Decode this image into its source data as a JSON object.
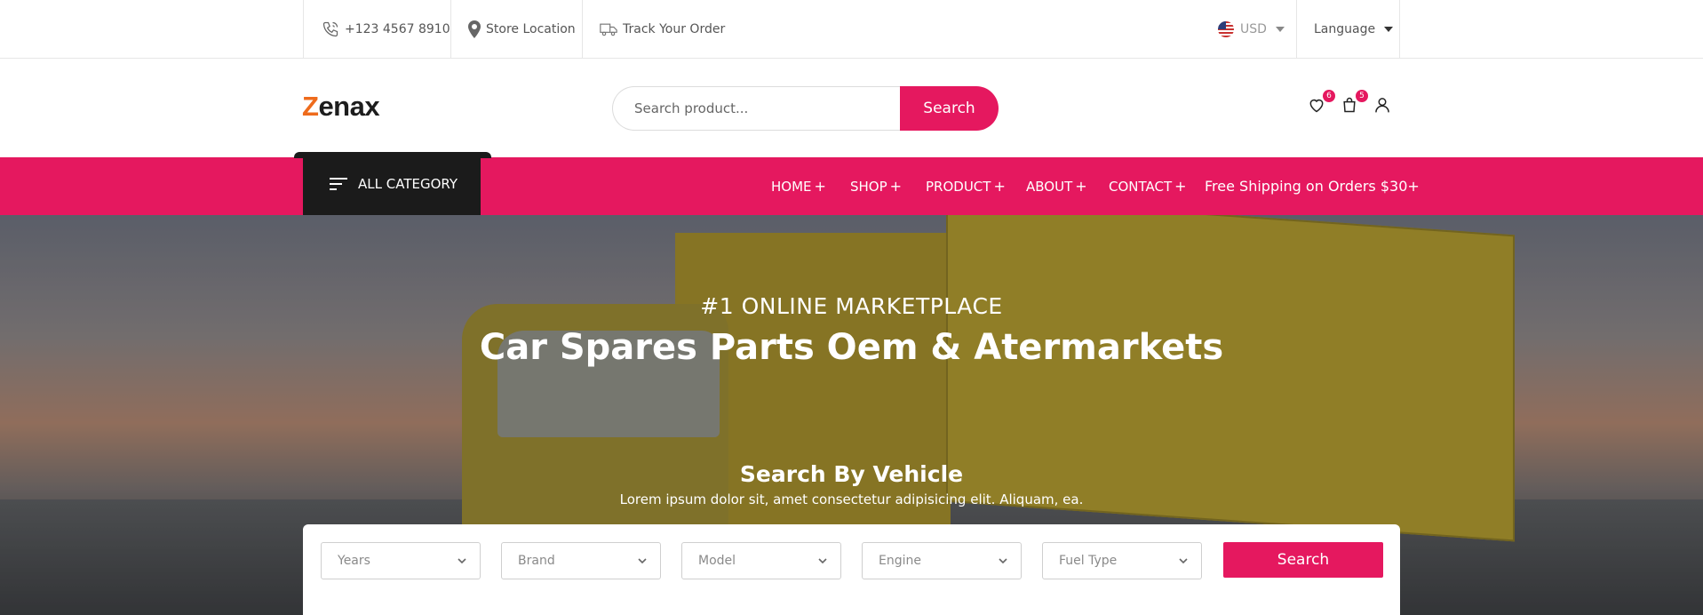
{
  "topbar": {
    "phone": "+123 4567 8910",
    "store": "Store Location",
    "track": "Track Your Order",
    "currency": "USD",
    "language": "Language"
  },
  "header": {
    "logo_first": "Z",
    "logo_rest": "enax",
    "search_placeholder": "Search product...",
    "search_button": "Search",
    "wishlist_count": "6",
    "cart_count": "5"
  },
  "nav": {
    "all_category": "ALL CATEGORY",
    "items": [
      {
        "label": "HOME"
      },
      {
        "label": "SHOP"
      },
      {
        "label": "PRODUCT"
      },
      {
        "label": "ABOUT"
      },
      {
        "label": "CONTACT"
      }
    ],
    "plus": "+",
    "free_shipping": "Free Shipping on Orders $30+"
  },
  "hero": {
    "subtitle": "#1 ONLINE MARKETPLACE",
    "title": "Car Spares Parts Oem & Atermarkets"
  },
  "vehicle_search": {
    "title": "Search By Vehicle",
    "description": "Lorem ipsum dolor sit, amet consectetur adipisicing elit. Aliquam, ea.",
    "selects": [
      {
        "label": "Years"
      },
      {
        "label": "Brand"
      },
      {
        "label": "Model"
      },
      {
        "label": "Engine"
      },
      {
        "label": "Fuel Type"
      }
    ],
    "button": "Search"
  },
  "colors": {
    "accent": "#e5185f",
    "dark": "#1b1b1b",
    "logo_accent": "#ee6b1c"
  }
}
